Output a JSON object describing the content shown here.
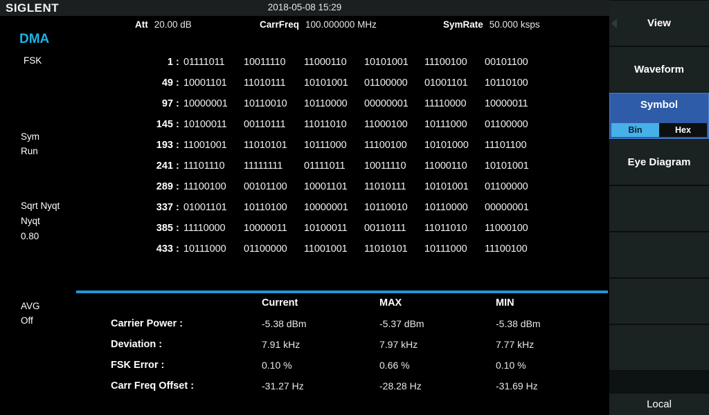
{
  "titlebar": {
    "logo": "SIGLENT",
    "datetime": "2018-05-08 15:29"
  },
  "params": [
    {
      "key": "Att",
      "value": "20.00 dB"
    },
    {
      "key": "CarrFreq",
      "value": "100.000000 MHz"
    },
    {
      "key": "SymRate",
      "value": "50.000 ksps"
    }
  ],
  "left_status": {
    "mode": "DMA",
    "modulation": "FSK",
    "sym": "Sym",
    "run": "Run",
    "filter": "Sqrt Nyqt",
    "filter2": "Nyqt",
    "alpha": "0.80",
    "avg": "AVG",
    "avg_state": "Off"
  },
  "symbol_table": {
    "rows": [
      {
        "index": "1",
        "cells": [
          "01111011",
          "10011110",
          "11000110",
          "10101001",
          "11100100",
          "00101100"
        ]
      },
      {
        "index": "49",
        "cells": [
          "10001101",
          "11010111",
          "10101001",
          "01100000",
          "01001101",
          "10110100"
        ]
      },
      {
        "index": "97",
        "cells": [
          "10000001",
          "10110010",
          "10110000",
          "00000001",
          "11110000",
          "10000011"
        ]
      },
      {
        "index": "145",
        "cells": [
          "10100011",
          "00110111",
          "11011010",
          "11000100",
          "10111000",
          "01100000"
        ]
      },
      {
        "index": "193",
        "cells": [
          "11001001",
          "11010101",
          "10111000",
          "11100100",
          "10101000",
          "11101100"
        ]
      },
      {
        "index": "241",
        "cells": [
          "11101110",
          "11111111",
          "01111011",
          "10011110",
          "11000110",
          "10101001"
        ]
      },
      {
        "index": "289",
        "cells": [
          "11100100",
          "00101100",
          "10001101",
          "11010111",
          "10101001",
          "01100000"
        ]
      },
      {
        "index": "337",
        "cells": [
          "01001101",
          "10110100",
          "10000001",
          "10110010",
          "10110000",
          "00000001"
        ]
      },
      {
        "index": "385",
        "cells": [
          "11110000",
          "10000011",
          "10100011",
          "00110111",
          "11011010",
          "11000100"
        ]
      },
      {
        "index": "433",
        "cells": [
          "10111000",
          "01100000",
          "11001001",
          "11010101",
          "10111000",
          "11100100"
        ]
      }
    ],
    "separator": ":"
  },
  "results": {
    "headers": [
      "Current",
      "MAX",
      "MIN"
    ],
    "rows": [
      {
        "label": "Carrier Power :",
        "current": "-5.38 dBm",
        "max": "-5.37 dBm",
        "min": "-5.38 dBm"
      },
      {
        "label": "Deviation :",
        "current": "7.91 kHz",
        "max": "7.97 kHz",
        "min": "7.77 kHz"
      },
      {
        "label": "FSK Error :",
        "current": "0.10 %",
        "max": "0.66 %",
        "min": "0.10 %"
      },
      {
        "label": "Carr Freq Offset :",
        "current": "-31.27 Hz",
        "max": "-28.28 Hz",
        "min": "-31.69 Hz"
      }
    ]
  },
  "softkeys": {
    "header": "View",
    "items": [
      {
        "label": "Waveform",
        "active": false
      },
      {
        "label": "Symbol",
        "active": true
      },
      {
        "label": "Eye Diagram",
        "active": false
      },
      {
        "label": "",
        "active": false
      },
      {
        "label": "",
        "active": false
      },
      {
        "label": "",
        "active": false
      },
      {
        "label": "",
        "active": false
      }
    ],
    "symbol_toggle": {
      "options": [
        "Bin",
        "Hex"
      ],
      "selected": "Bin"
    },
    "local": "Local"
  },
  "colors": {
    "accent_blue": "#2196d6",
    "mode_cyan": "#1ab4e8",
    "active_key": "#2f5ca8",
    "toggle_selected": "#46b0e8"
  }
}
